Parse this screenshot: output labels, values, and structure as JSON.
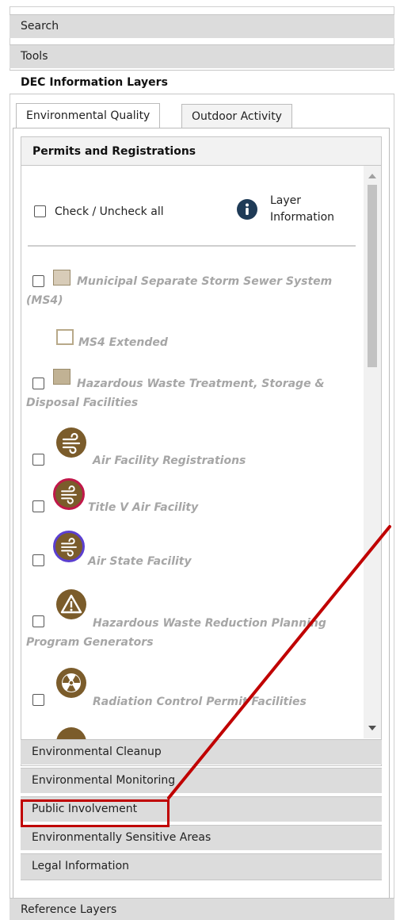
{
  "top_sections": {
    "search": "Search",
    "tools": "Tools",
    "dec_layers": "DEC Information Layers"
  },
  "tabs": {
    "environmental_quality": "Environmental Quality",
    "outdoor_activity": "Outdoor Activity"
  },
  "panel": {
    "title": "Permits and Registrations",
    "check_all": "Check / Uncheck all",
    "layer_info_line1": "Layer",
    "layer_info_line2": "Information"
  },
  "layers": {
    "ms4_line1": "Municipal Separate Storm Sewer System",
    "ms4_line2": "(MS4)",
    "ms4_extended": "MS4 Extended",
    "hazwaste_line1": "Hazardous Waste Treatment, Storage &",
    "hazwaste_line2": "Disposal Facilities",
    "air_facility": "Air Facility Registrations",
    "title_v": "Title V Air Facility",
    "air_state": "Air State Facility",
    "hw_reduction_line1": "Hazardous Waste Reduction Planning",
    "hw_reduction_line2": "Program Generators",
    "radiation": "Radiation Control Permit Facilities"
  },
  "sub_sections": {
    "cleanup": "Environmental Cleanup",
    "monitoring": "Environmental Monitoring",
    "public_involvement": "Public Involvement",
    "sensitive_areas": "Environmentally Sensitive Areas",
    "legal": "Legal Information"
  },
  "bottom_sections": {
    "reference_layers": "Reference Layers"
  },
  "colors": {
    "highlight": "#c00000",
    "icon_brown": "#7b5c2b",
    "title_v_ring": "#c0184a",
    "air_state_ring": "#5b3fd0",
    "info_icon": "#1f3b57"
  },
  "icons": {
    "info": "info-circle-icon",
    "air": "wind-icon",
    "hazard": "warning-triangle-icon",
    "radiation": "radiation-icon"
  }
}
